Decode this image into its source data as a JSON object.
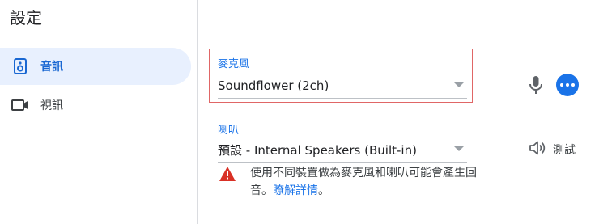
{
  "page": {
    "title": "設定"
  },
  "sidebar": {
    "items": [
      {
        "label": "音訊",
        "icon": "speaker-icon",
        "active": true
      },
      {
        "label": "視訊",
        "icon": "video-camera-icon",
        "active": false
      }
    ]
  },
  "microphone": {
    "label": "麥克風",
    "value": "Soundflower (2ch)",
    "icon": "microphone-icon",
    "more_icon": "more-horizontal-icon"
  },
  "speaker": {
    "label": "喇叭",
    "value": "預設 - Internal Speakers (Built-in)",
    "test_label": "測試",
    "test_icon": "volume-icon"
  },
  "warning": {
    "icon": "warning-triangle-icon",
    "text": "使用不同裝置做為麥克風和喇叭可能會產生回音。",
    "link": "瞭解詳情",
    "suffix": "。"
  },
  "colors": {
    "accent": "#1a73e8",
    "active_bg": "#e8f0fe",
    "highlight_border": "#e06666",
    "warning": "#d93025"
  }
}
